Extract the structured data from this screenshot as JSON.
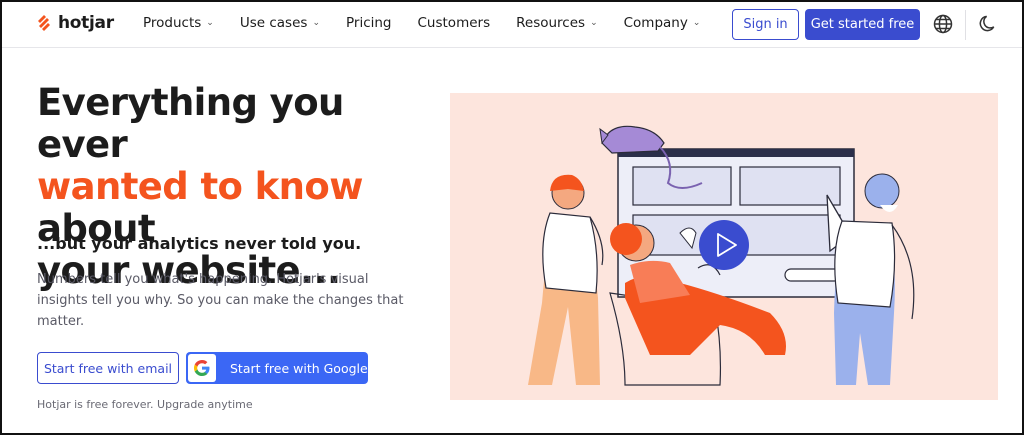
{
  "brand": {
    "name": "hotjar",
    "accent": "#f4541e",
    "primary": "#3a4ccf"
  },
  "nav": {
    "items": [
      {
        "label": "Products",
        "has_dropdown": true
      },
      {
        "label": "Use cases",
        "has_dropdown": true
      },
      {
        "label": "Pricing",
        "has_dropdown": false
      },
      {
        "label": "Customers",
        "has_dropdown": false
      },
      {
        "label": "Resources",
        "has_dropdown": true
      },
      {
        "label": "Company",
        "has_dropdown": true
      }
    ],
    "chevron": "⌄",
    "sign_in": "Sign in",
    "get_started": "Get started free",
    "icons": [
      "globe-icon",
      "moon-icon"
    ]
  },
  "hero": {
    "title_line1": "Everything you ever",
    "title_accent": "wanted to know",
    "title_after_accent": " about",
    "title_line3": "your website...",
    "subhead": "...but your analytics never told you.",
    "description": "Numbers tell you what's happening. Hotjar's visual insights tell you why. So you can make the changes that matter.",
    "cta_email": "Start free with email",
    "cta_google": "Start free with Google",
    "note": "Hotjar is free forever. Upgrade anytime"
  },
  "illustration": {
    "background": "#fde5dd",
    "play_button_color": "#3a4ccf",
    "icons": [
      "play-icon"
    ]
  }
}
